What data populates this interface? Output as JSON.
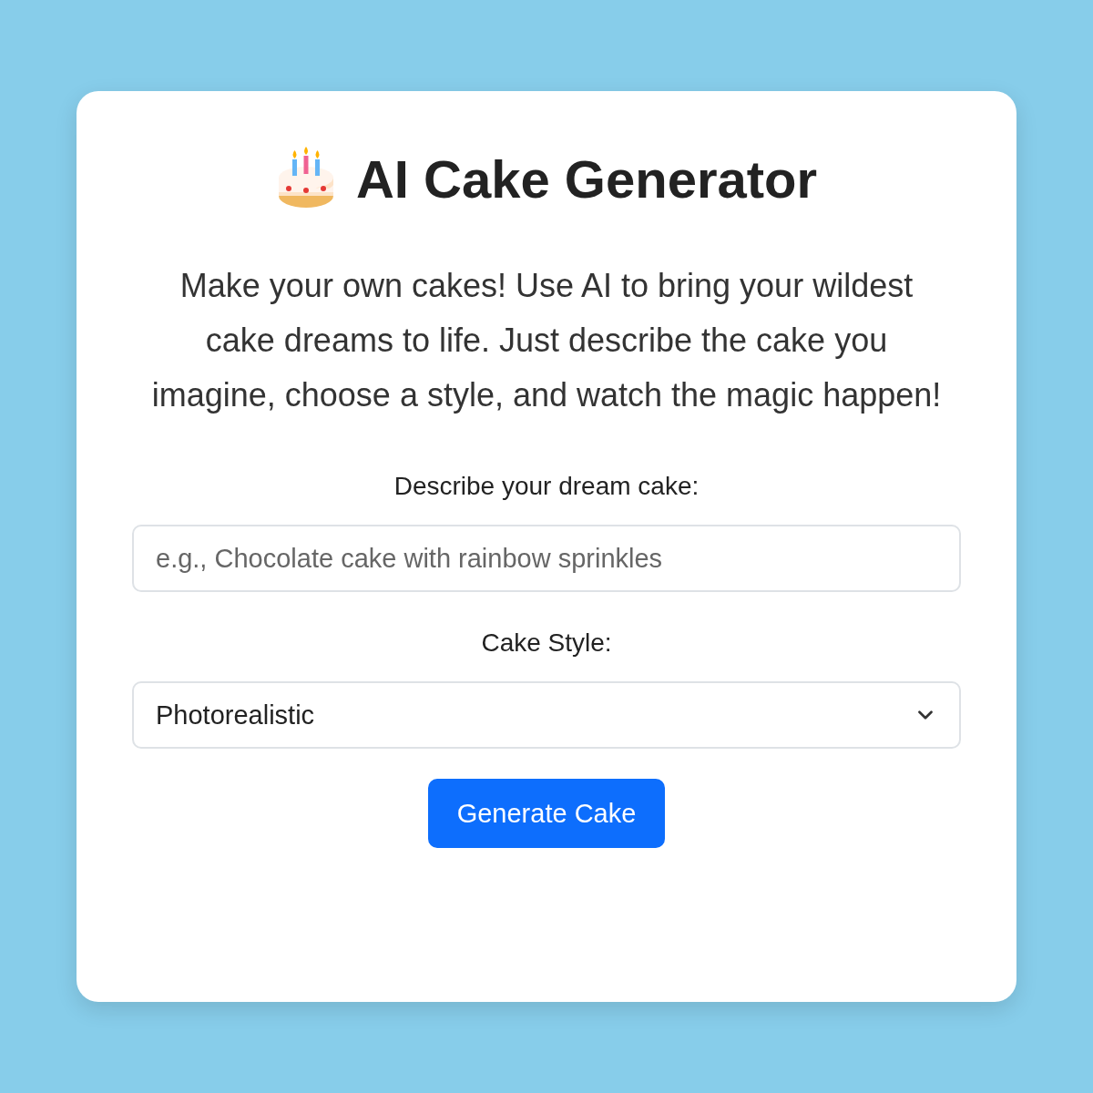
{
  "title": "AI Cake Generator",
  "description": "Make your own cakes! Use AI to bring your wildest cake dreams to life. Just describe the cake you imagine, choose a style, and watch the magic happen!",
  "prompt_field": {
    "label": "Describe your dream cake:",
    "placeholder": "e.g., Chocolate cake with rainbow sprinkles"
  },
  "style_select": {
    "label": "Cake Style:",
    "value": "Photorealistic"
  },
  "button": "Generate Cake"
}
